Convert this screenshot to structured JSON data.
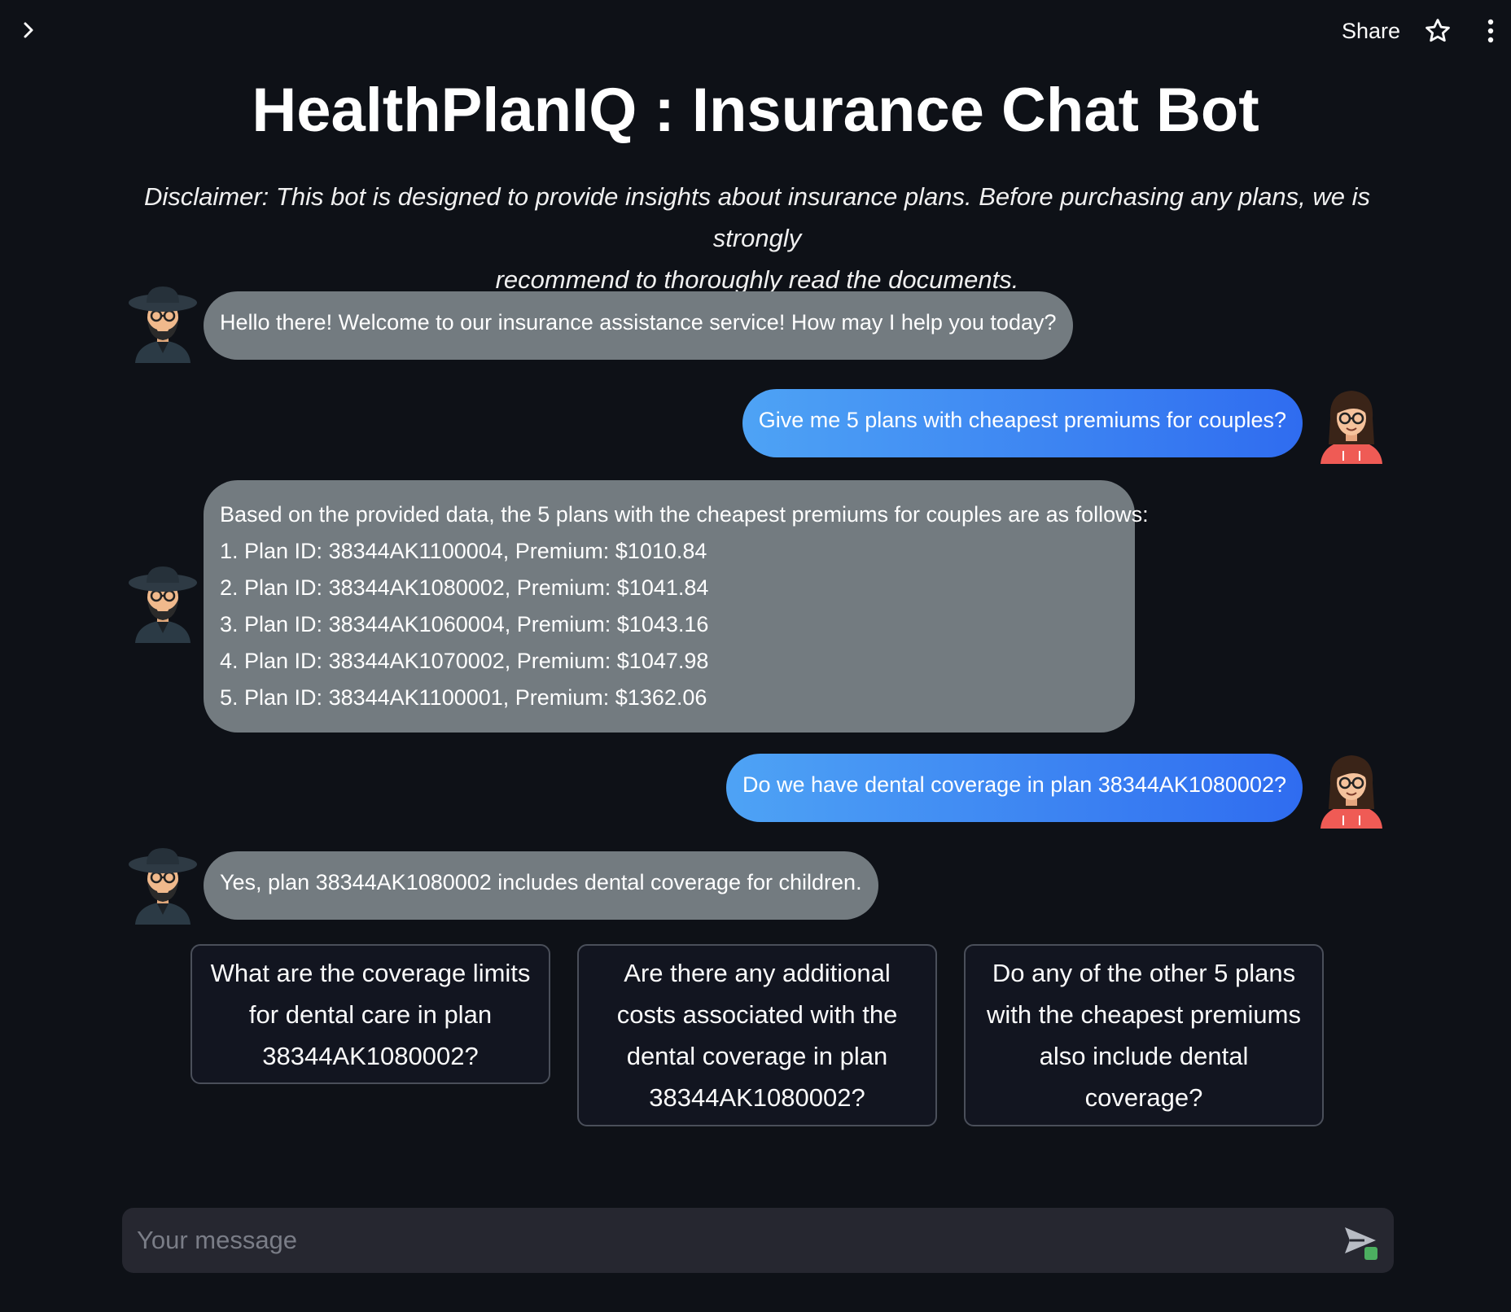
{
  "topbar": {
    "expand_icon": "chevron-right-icon",
    "share_label": "Share",
    "star_icon": "star-icon",
    "menu_icon": "more-vertical-icon"
  },
  "header": {
    "title": "HealthPlanIQ : Insurance Chat Bot",
    "disclaimer_line1": "Disclaimer: This bot is designed to provide insights about insurance plans. Before purchasing any plans, we is strongly",
    "disclaimer_line2": "recommend to thoroughly read the documents."
  },
  "messages": [
    {
      "role": "bot",
      "lines": [
        "Hello there! Welcome to our insurance assistance service! How may I help you today?"
      ]
    },
    {
      "role": "user",
      "lines": [
        "Give me 5 plans with cheapest premiums for couples?"
      ]
    },
    {
      "role": "bot",
      "lines": [
        "Based on the provided data, the 5 plans with the cheapest premiums for couples are as follows:",
        "1. Plan ID: 38344AK1100004, Premium: $1010.84",
        "2. Plan ID: 38344AK1080002, Premium: $1041.84",
        "3. Plan ID: 38344AK1060004, Premium: $1043.16",
        "4. Plan ID: 38344AK1070002, Premium: $1047.98",
        "5. Plan ID: 38344AK1100001, Premium: $1362.06"
      ]
    },
    {
      "role": "user",
      "lines": [
        "Do we have dental coverage in plan 38344AK1080002?"
      ]
    },
    {
      "role": "bot",
      "lines": [
        "Yes, plan 38344AK1080002 includes dental coverage for children."
      ]
    }
  ],
  "suggestions": [
    {
      "lines": [
        "What are the coverage limits",
        "for dental care in plan",
        "38344AK1080002?"
      ]
    },
    {
      "lines": [
        "Are there any additional",
        "costs associated with the",
        "dental coverage in plan",
        "38344AK1080002?"
      ]
    },
    {
      "lines": [
        "Do any of the other 5 plans",
        "with the cheapest premiums",
        "also include dental",
        "coverage?"
      ]
    }
  ],
  "input": {
    "placeholder": "Your message",
    "send_icon": "send-icon"
  },
  "colors": {
    "background": "#0e1117",
    "bot_bubble": "#737b80",
    "user_bubble_start": "#4ea3f5",
    "user_bubble_end": "#2f6cf0",
    "input_bg": "#262730"
  }
}
